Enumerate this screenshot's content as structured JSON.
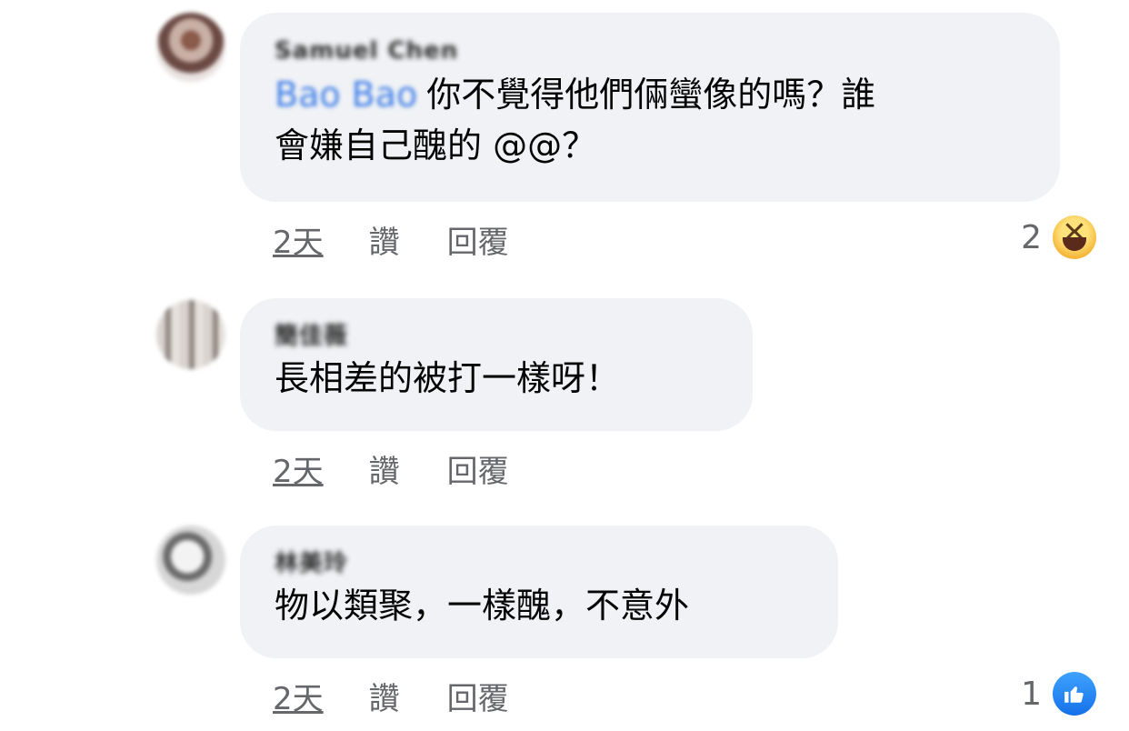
{
  "comments": [
    {
      "author": "Samuel Chen",
      "mention": "Bao Bao",
      "text_line1": "你不覺得他們倆蠻像的嗎？誰",
      "text_line2": "會嫌自己醜的 @@？",
      "time": "2天",
      "like_label": "讚",
      "reply_label": "回覆",
      "reaction_count": "2",
      "reaction_icon": "haha-icon"
    },
    {
      "author": "簡佳薇",
      "text": "長相差的被打一樣呀！",
      "time": "2天",
      "like_label": "讚",
      "reply_label": "回覆"
    },
    {
      "author": "林美玲",
      "text": "物以類聚，一樣醜，不意外",
      "time": "2天",
      "like_label": "讚",
      "reply_label": "回覆",
      "reaction_count": "1",
      "reaction_icon": "thumbs-up-icon"
    }
  ],
  "colors": {
    "bubble": "#f0f2f5",
    "meta_text": "#65676b",
    "mention": "#3f7ee8",
    "like_blue": "#1877f2"
  }
}
